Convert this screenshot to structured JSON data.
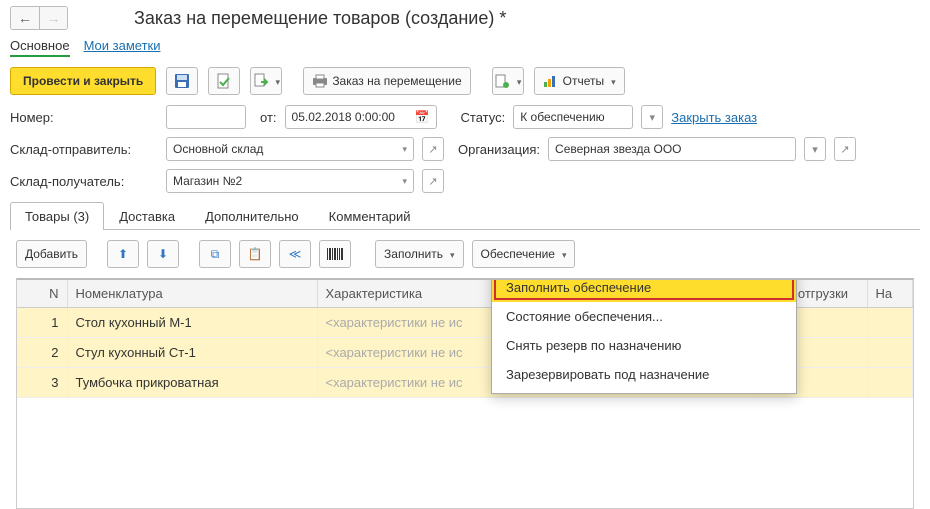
{
  "title": "Заказ на перемещение товаров (создание) *",
  "navtabs": {
    "main": "Основное",
    "notes": "Мои заметки"
  },
  "toolbar": {
    "submit": "Провести и закрыть",
    "print": "Заказ на перемещение",
    "reports": "Отчеты"
  },
  "form": {
    "number_label": "Номер:",
    "from_label": "от:",
    "date": "05.02.2018  0:00:00",
    "status_label": "Статус:",
    "status_value": "К обеспечению",
    "close_link": "Закрыть заказ",
    "sender_label": "Склад-отправитель:",
    "sender_value": "Основной склад",
    "org_label": "Организация:",
    "org_value": "Северная звезда ООО",
    "receiver_label": "Склад-получатель:",
    "receiver_value": "Магазин №2"
  },
  "tabs": {
    "goods": "Товары (3)",
    "delivery": "Доставка",
    "extra": "Дополнительно",
    "comment": "Комментарий"
  },
  "table_toolbar": {
    "add": "Добавить",
    "fill": "Заполнить",
    "provision": "Обеспечение"
  },
  "columns": {
    "n": "N",
    "nom": "Номенклатура",
    "char": "Характеристика",
    "ship": "Дата отгрузки",
    "last": "На"
  },
  "rows": [
    {
      "n": "1",
      "nom": "Стол кухонный М-1",
      "char": "<характеристики не ис"
    },
    {
      "n": "2",
      "nom": "Стул кухонный Ст-1",
      "char": "<характеристики не ис"
    },
    {
      "n": "3",
      "nom": "Тумбочка прикроватная",
      "char": "<характеристики не ис"
    }
  ],
  "menu": {
    "fill_prov": "Заполнить обеспечение",
    "state": "Состояние обеспечения...",
    "release": "Снять резерв по назначению",
    "reserve": "Зарезервировать под назначение"
  }
}
